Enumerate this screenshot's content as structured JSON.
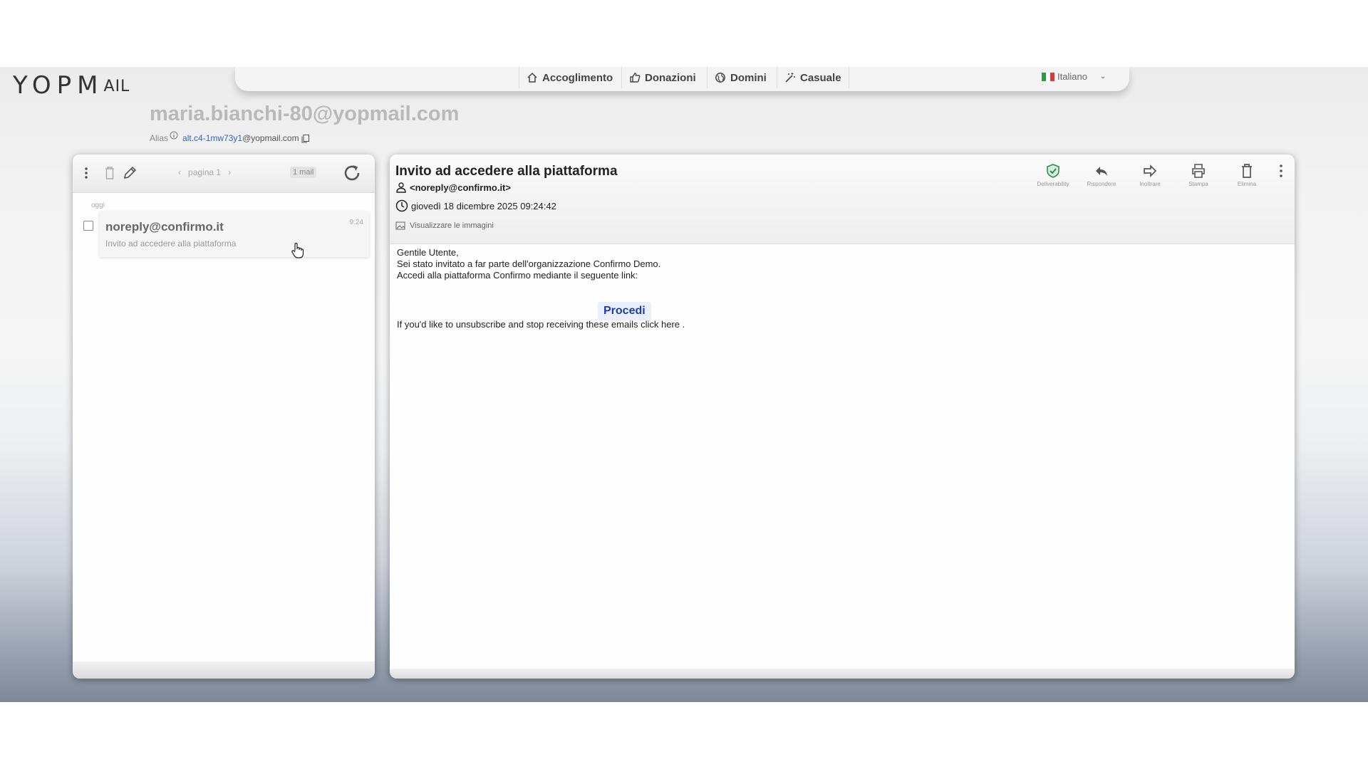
{
  "logo": {
    "big": "YOPM",
    "small": "AIL"
  },
  "nav": {
    "items": [
      {
        "label": "Accoglimento",
        "icon": "home-icon"
      },
      {
        "label": "Donazioni",
        "icon": "thumbs-up-icon"
      },
      {
        "label": "Domini",
        "icon": "globe-icon"
      },
      {
        "label": "Casuale",
        "icon": "magic-wand-icon"
      }
    ],
    "language": "Italiano"
  },
  "inbox": {
    "address": "maria.bianchi-80@yopmail.com",
    "alias_label": "Alias",
    "alias_value": "alt.c4-1mw73y1",
    "alias_domain": "@yopmail.com"
  },
  "list": {
    "pager": "pagina 1",
    "count": "1 mail",
    "day_label": "oggi",
    "items": [
      {
        "sender": "noreply@confirmo.it",
        "subject": "Invito ad accedere alla piattaforma",
        "time": "9:24"
      }
    ]
  },
  "message": {
    "subject": "Invito ad accedere alla piattaforma",
    "from": "<noreply@confirmo.it>",
    "date": "giovedì 18 dicembre 2025 09:24:42",
    "images_label": "Visualizzare le immagini",
    "actions": [
      {
        "label": "Deliverability",
        "icon": "shield-check-icon"
      },
      {
        "label": "Rispondere",
        "icon": "reply-icon"
      },
      {
        "label": "Inoltrare",
        "icon": "forward-icon"
      },
      {
        "label": "Stampa",
        "icon": "print-icon"
      },
      {
        "label": "Elimina",
        "icon": "trash-icon"
      }
    ],
    "body_lines": [
      "Gentile Utente,",
      "Sei stato invitato a far parte dell'organizzazione Confirmo Demo.",
      "Accedi alla piattaforma Confirmo mediante il seguente link:"
    ],
    "cta": "Procedi",
    "unsubscribe": "If you'd like to unsubscribe and stop receiving these emails click here ."
  },
  "colors": {
    "accent": "#2b66c9",
    "cta_text": "#1d3fa3",
    "shield": "#2e8b57"
  }
}
